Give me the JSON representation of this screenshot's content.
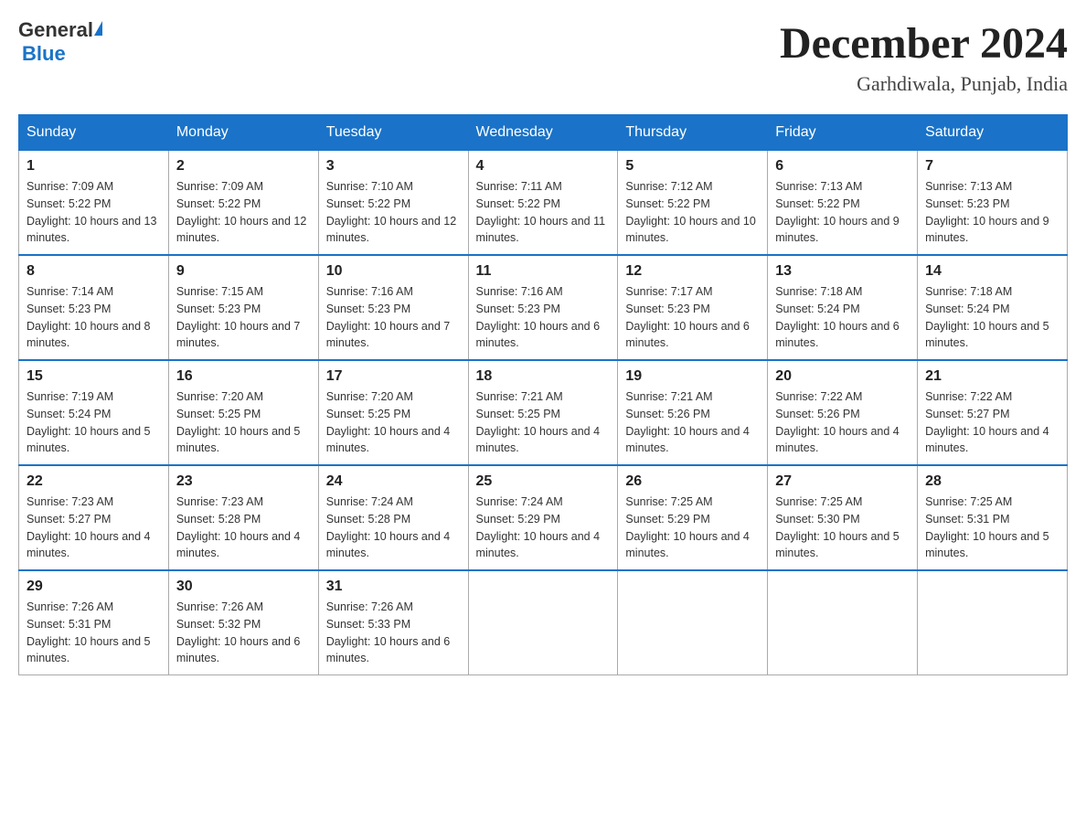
{
  "header": {
    "logo_general": "General",
    "logo_blue": "Blue",
    "title": "December 2024",
    "subtitle": "Garhdiwala, Punjab, India"
  },
  "weekdays": [
    "Sunday",
    "Monday",
    "Tuesday",
    "Wednesday",
    "Thursday",
    "Friday",
    "Saturday"
  ],
  "weeks": [
    [
      {
        "day": "1",
        "sunrise": "7:09 AM",
        "sunset": "5:22 PM",
        "daylight": "10 hours and 13 minutes."
      },
      {
        "day": "2",
        "sunrise": "7:09 AM",
        "sunset": "5:22 PM",
        "daylight": "10 hours and 12 minutes."
      },
      {
        "day": "3",
        "sunrise": "7:10 AM",
        "sunset": "5:22 PM",
        "daylight": "10 hours and 12 minutes."
      },
      {
        "day": "4",
        "sunrise": "7:11 AM",
        "sunset": "5:22 PM",
        "daylight": "10 hours and 11 minutes."
      },
      {
        "day": "5",
        "sunrise": "7:12 AM",
        "sunset": "5:22 PM",
        "daylight": "10 hours and 10 minutes."
      },
      {
        "day": "6",
        "sunrise": "7:13 AM",
        "sunset": "5:22 PM",
        "daylight": "10 hours and 9 minutes."
      },
      {
        "day": "7",
        "sunrise": "7:13 AM",
        "sunset": "5:23 PM",
        "daylight": "10 hours and 9 minutes."
      }
    ],
    [
      {
        "day": "8",
        "sunrise": "7:14 AM",
        "sunset": "5:23 PM",
        "daylight": "10 hours and 8 minutes."
      },
      {
        "day": "9",
        "sunrise": "7:15 AM",
        "sunset": "5:23 PM",
        "daylight": "10 hours and 7 minutes."
      },
      {
        "day": "10",
        "sunrise": "7:16 AM",
        "sunset": "5:23 PM",
        "daylight": "10 hours and 7 minutes."
      },
      {
        "day": "11",
        "sunrise": "7:16 AM",
        "sunset": "5:23 PM",
        "daylight": "10 hours and 6 minutes."
      },
      {
        "day": "12",
        "sunrise": "7:17 AM",
        "sunset": "5:23 PM",
        "daylight": "10 hours and 6 minutes."
      },
      {
        "day": "13",
        "sunrise": "7:18 AM",
        "sunset": "5:24 PM",
        "daylight": "10 hours and 6 minutes."
      },
      {
        "day": "14",
        "sunrise": "7:18 AM",
        "sunset": "5:24 PM",
        "daylight": "10 hours and 5 minutes."
      }
    ],
    [
      {
        "day": "15",
        "sunrise": "7:19 AM",
        "sunset": "5:24 PM",
        "daylight": "10 hours and 5 minutes."
      },
      {
        "day": "16",
        "sunrise": "7:20 AM",
        "sunset": "5:25 PM",
        "daylight": "10 hours and 5 minutes."
      },
      {
        "day": "17",
        "sunrise": "7:20 AM",
        "sunset": "5:25 PM",
        "daylight": "10 hours and 4 minutes."
      },
      {
        "day": "18",
        "sunrise": "7:21 AM",
        "sunset": "5:25 PM",
        "daylight": "10 hours and 4 minutes."
      },
      {
        "day": "19",
        "sunrise": "7:21 AM",
        "sunset": "5:26 PM",
        "daylight": "10 hours and 4 minutes."
      },
      {
        "day": "20",
        "sunrise": "7:22 AM",
        "sunset": "5:26 PM",
        "daylight": "10 hours and 4 minutes."
      },
      {
        "day": "21",
        "sunrise": "7:22 AM",
        "sunset": "5:27 PM",
        "daylight": "10 hours and 4 minutes."
      }
    ],
    [
      {
        "day": "22",
        "sunrise": "7:23 AM",
        "sunset": "5:27 PM",
        "daylight": "10 hours and 4 minutes."
      },
      {
        "day": "23",
        "sunrise": "7:23 AM",
        "sunset": "5:28 PM",
        "daylight": "10 hours and 4 minutes."
      },
      {
        "day": "24",
        "sunrise": "7:24 AM",
        "sunset": "5:28 PM",
        "daylight": "10 hours and 4 minutes."
      },
      {
        "day": "25",
        "sunrise": "7:24 AM",
        "sunset": "5:29 PM",
        "daylight": "10 hours and 4 minutes."
      },
      {
        "day": "26",
        "sunrise": "7:25 AM",
        "sunset": "5:29 PM",
        "daylight": "10 hours and 4 minutes."
      },
      {
        "day": "27",
        "sunrise": "7:25 AM",
        "sunset": "5:30 PM",
        "daylight": "10 hours and 5 minutes."
      },
      {
        "day": "28",
        "sunrise": "7:25 AM",
        "sunset": "5:31 PM",
        "daylight": "10 hours and 5 minutes."
      }
    ],
    [
      {
        "day": "29",
        "sunrise": "7:26 AM",
        "sunset": "5:31 PM",
        "daylight": "10 hours and 5 minutes."
      },
      {
        "day": "30",
        "sunrise": "7:26 AM",
        "sunset": "5:32 PM",
        "daylight": "10 hours and 6 minutes."
      },
      {
        "day": "31",
        "sunrise": "7:26 AM",
        "sunset": "5:33 PM",
        "daylight": "10 hours and 6 minutes."
      },
      null,
      null,
      null,
      null
    ]
  ]
}
